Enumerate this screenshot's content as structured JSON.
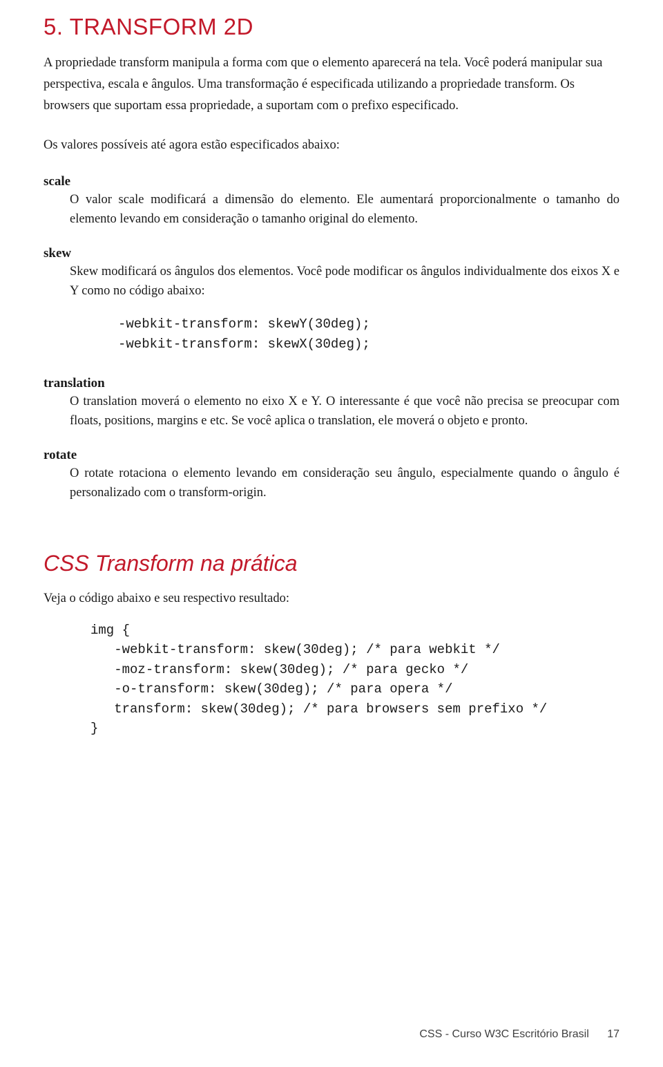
{
  "title": "5. TRANSFORM 2D",
  "intro": "A propriedade transform manipula a forma com que o elemento aparecerá na tela. Você poderá manipular sua perspectiva, escala e ângulos. Uma transformação é especificada utilizando a propriedade transform. Os browsers que suportam essa propriedade, a suportam  com o prefixo especificado.",
  "sub_intro": "Os valores possíveis até agora estão especificados abaixo:",
  "defs": {
    "scale": {
      "term": "scale",
      "desc": "O valor scale modificará a dimensão do elemento. Ele aumentará proporcionalmente o tamanho do elemento levando em consideração o tamanho original do elemento."
    },
    "skew": {
      "term": "skew",
      "desc": "Skew modificará os ângulos dos elementos. Você pode modificar os ângulos individualmente dos eixos X e Y como no código abaixo:"
    },
    "translation": {
      "term": "translation",
      "desc": "O translation moverá o elemento no eixo X e Y. O interessante é que você não precisa se preocupar com floats, positions, margins e etc. Se você aplica o translation, ele moverá o objeto e pronto."
    },
    "rotate": {
      "term": "rotate",
      "desc": "O rotate rotaciona o elemento levando em consideração seu ângulo, especialmente quando o ângulo é personalizado com o transform-origin."
    }
  },
  "skew_code": "-webkit-transform: skewY(30deg);\n-webkit-transform: skewX(30deg);",
  "section2": {
    "title": "CSS Transform na prática",
    "intro": "Veja o código abaixo e seu respectivo resultado:",
    "code": "img {\n   -webkit-transform: skew(30deg); /* para webkit */\n   -moz-transform: skew(30deg); /* para gecko */\n   -o-transform: skew(30deg); /* para opera */\n   transform: skew(30deg); /* para browsers sem prefixo */\n}"
  },
  "footer": {
    "text": "CSS - Curso W3C Escritório Brasil",
    "page": "17"
  }
}
